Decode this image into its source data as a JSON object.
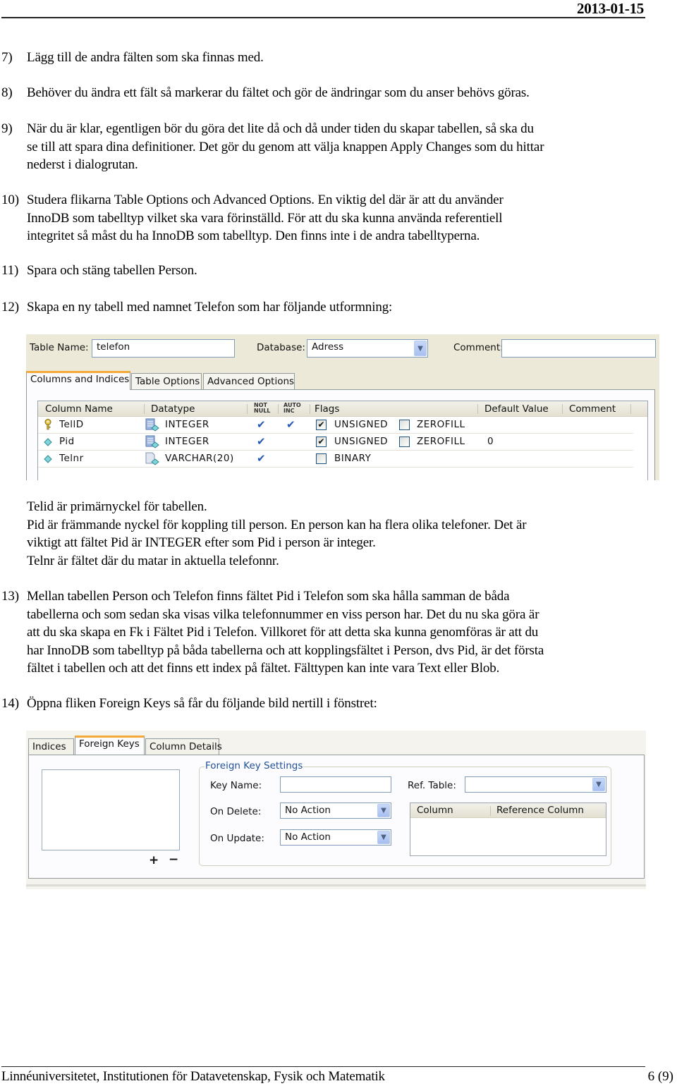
{
  "header": {
    "date": "2013-01-15"
  },
  "steps": [
    {
      "num": "7)",
      "lines": [
        "Lägg till de andra fälten som ska finnas med."
      ]
    },
    {
      "num": "8)",
      "lines": [
        "Behöver du ändra ett fält så markerar du fältet och gör de ändringar som du anser behövs göras."
      ]
    },
    {
      "num": "9)",
      "lines": [
        "När du är klar, egentligen bör du göra det lite då och då under tiden du skapar tabellen, så ska du",
        "se till att spara dina definitioner. Det gör du genom att välja knappen Apply Changes som du hittar",
        "nederst i dialogrutan."
      ]
    },
    {
      "num": "10)",
      "lines": [
        "Studera flikarna Table Options och Advanced Options. En viktig del där är att du använder",
        "InnoDB som tabelltyp vilket ska vara förinställd. För att du ska kunna använda referentiell",
        "integritet så måst du ha InnoDB som tabelltyp. Den finns inte i de andra tabelltyperna."
      ]
    },
    {
      "num": "11)",
      "lines": [
        "Spara och stäng tabellen Person."
      ]
    },
    {
      "num": "12)",
      "lines": [
        "Skapa en ny tabell med namnet Telefon som har följande utformning:"
      ]
    },
    {
      "num": "13)",
      "lines": [
        "Mellan tabellen Person och Telefon finns fältet Pid i Telefon som ska hålla samman de båda",
        "tabellerna och som sedan ska visas vilka telefonnummer en viss person har. Det du nu ska göra är",
        "att du ska skapa en Fk i Fältet Pid i Telefon. Villkoret för att detta ska kunna genomföras är att du",
        "har InnoDB som tabelltyp på båda tabellerna och att kopplingsfältet i Person, dvs Pid, är det första",
        "fältet i tabellen och att det finns ett index på fältet. Fälttypen kan inte vara Text eller Blob."
      ]
    },
    {
      "num": "14)",
      "lines": [
        "Öppna fliken Foreign Keys så får du följande bild nertill i fönstret:"
      ]
    }
  ],
  "notes": [
    "Telid är primärnyckel för tabellen.",
    "Pid är främmande nyckel för koppling till person. En person kan ha flera olika telefoner. Det är",
    "viktigt att fältet Pid är INTEGER efter som Pid i person är integer.",
    "Telnr är fältet där du matar in aktuella telefonnr."
  ],
  "table_editor": {
    "table_name_label": "Table Name:",
    "table_name_value": "telefon",
    "database_label": "Database:",
    "database_value": "Adress",
    "comment_label": "Comment:",
    "comment_value": "",
    "tabs": [
      "Columns and Indices",
      "Table Options",
      "Advanced Options"
    ],
    "active_tab": "Columns and Indices",
    "columns": {
      "col_name": "Column Name",
      "datatype": "Datatype",
      "not_null": [
        "NOT",
        "NULL"
      ],
      "auto_inc": [
        "AUTO",
        "INC"
      ],
      "flags": "Flags",
      "default_value": "Default Value",
      "comment": "Comment"
    },
    "rows": [
      {
        "icon": "primary-key-icon",
        "name": "TellD",
        "datatype": "INTEGER",
        "not_null": "✔",
        "auto_inc": "✔",
        "flags": [
          {
            "label": "UNSIGNED",
            "checked": "✔"
          },
          {
            "label": "ZEROFILL",
            "checked": ""
          }
        ],
        "default": "",
        "comment": ""
      },
      {
        "icon": "column-diamond-icon",
        "name": "Pid",
        "datatype": "INTEGER",
        "not_null": "✔",
        "auto_inc": "",
        "flags": [
          {
            "label": "UNSIGNED",
            "checked": "✔"
          },
          {
            "label": "ZEROFILL",
            "checked": ""
          }
        ],
        "default": "0",
        "comment": ""
      },
      {
        "icon": "column-diamond-icon",
        "name": "Telnr",
        "datatype": "VARCHAR(20)",
        "not_null": "✔",
        "auto_inc": "",
        "flags": [
          {
            "label": "BINARY",
            "checked": ""
          }
        ],
        "default": "",
        "comment": ""
      }
    ]
  },
  "fk_editor": {
    "tabs": [
      "Indices",
      "Foreign Keys",
      "Column Details"
    ],
    "active_tab": "Foreign Keys",
    "group_title": "Foreign Key Settings",
    "key_name_label": "Key Name:",
    "key_name_value": "",
    "ref_table_label": "Ref. Table:",
    "ref_table_value": "",
    "on_delete_label": "On Delete:",
    "on_delete_value": "No Action",
    "on_update_label": "On Update:",
    "on_update_value": "No Action",
    "mapping_columns": [
      "Column",
      "Reference Column"
    ],
    "add_label": "+",
    "remove_label": "−"
  },
  "footer": {
    "institution": "Linnéuniversitetet, Institutionen för Datavetenskap, Fysik och Matematik",
    "page": "6 (9)"
  }
}
